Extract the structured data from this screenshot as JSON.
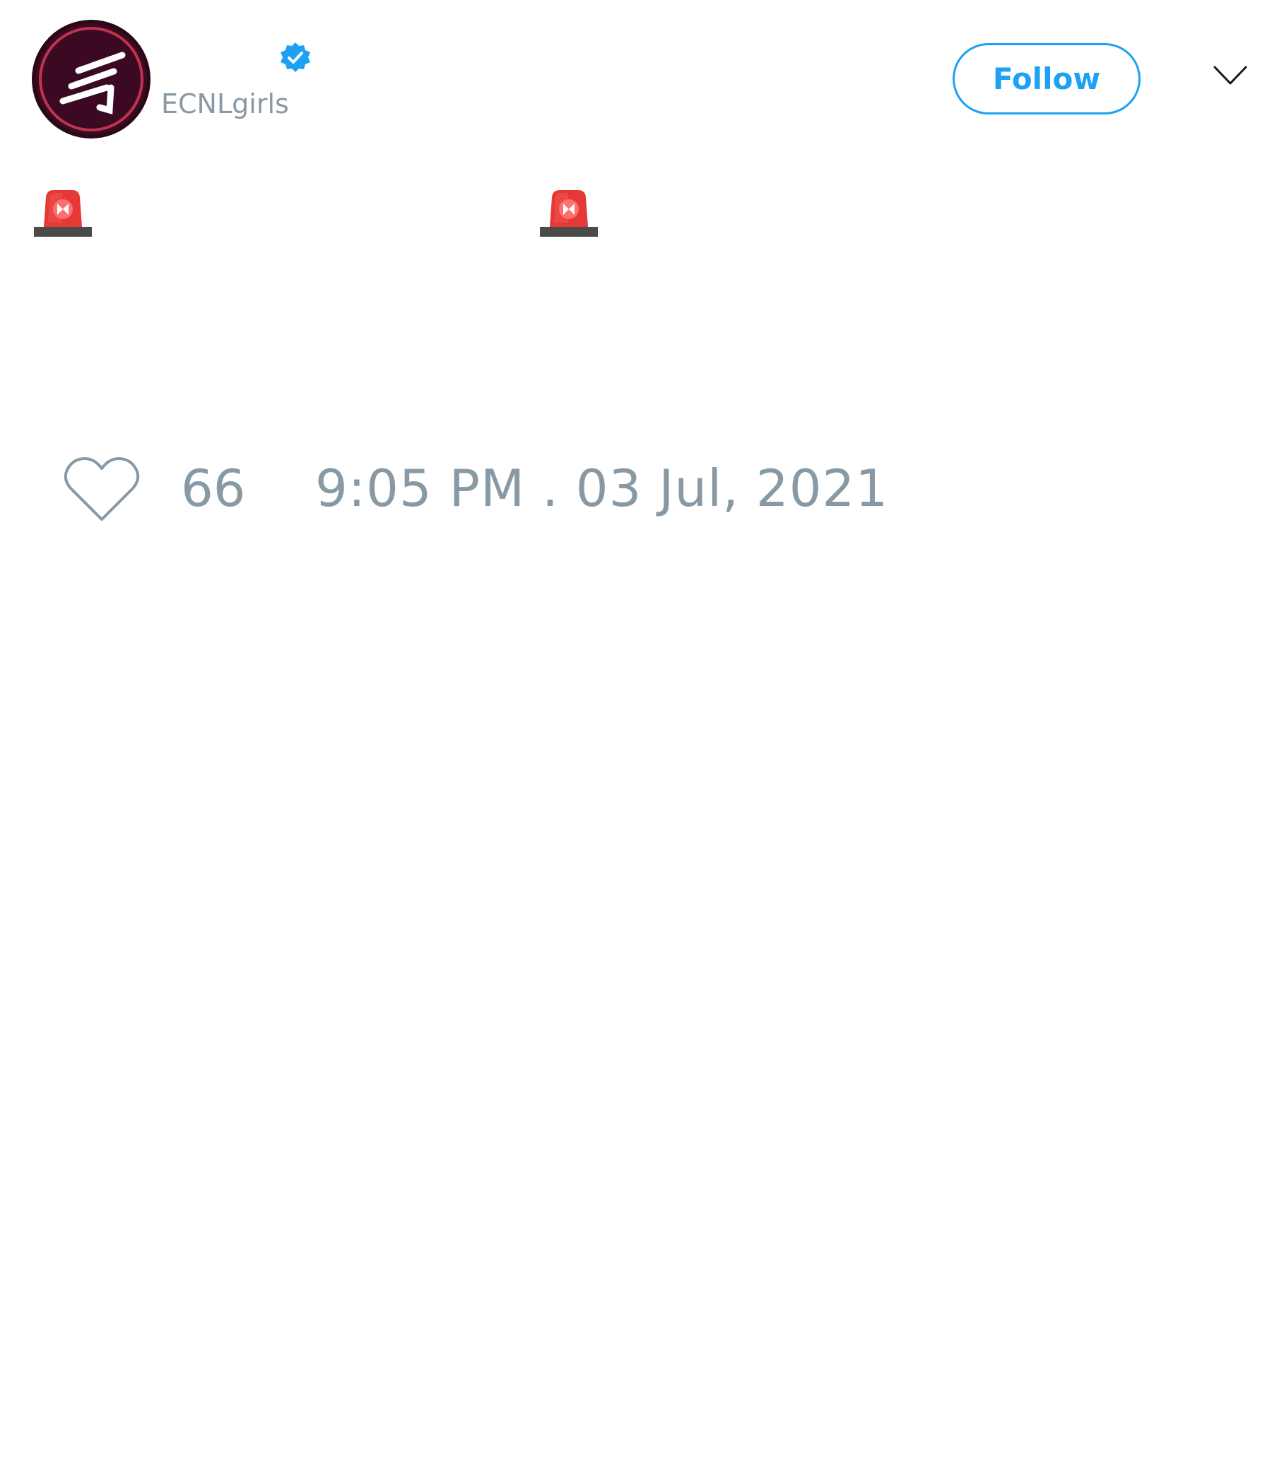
{
  "tweet": {
    "author": {
      "handle": "ECNLgirls",
      "verified": true,
      "avatar_icon": "ecnl-logo",
      "avatar_bg": "#3b0a22",
      "avatar_ring": "#c0334f"
    },
    "follow_label": "Follow",
    "menu_icon": "chevron-down-icon",
    "text_emoji": [
      "police-car-light",
      "police-car-light"
    ],
    "text": "",
    "like_icon": "heart-icon",
    "like_count": "66",
    "timestamp": "9:05 PM . 03 Jul, 2021"
  },
  "colors": {
    "accent": "#1da1f2",
    "muted": "#8899a6",
    "verified": "#1da1f2",
    "siren_red": "#e53935",
    "siren_base": "#4a4a4a"
  }
}
